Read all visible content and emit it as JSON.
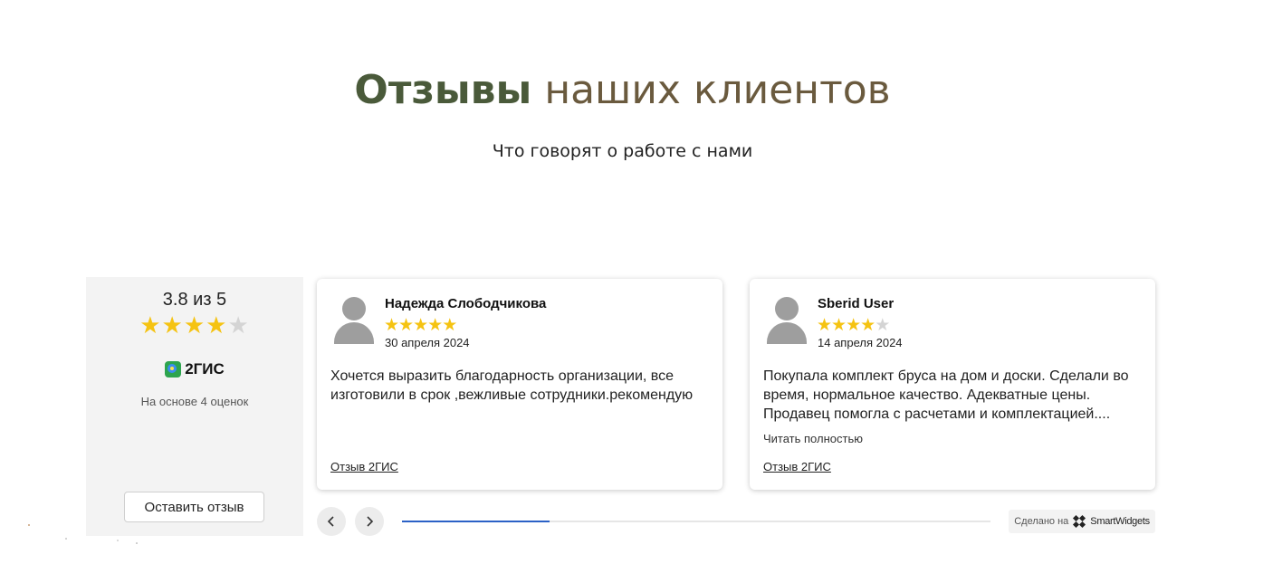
{
  "header": {
    "title_bold": "Отзывы",
    "title_rest": "наших клиентов",
    "subtitle": "Что говорят о работе с нами"
  },
  "summary": {
    "rating_text": "3.8 из 5",
    "rating": 3.8,
    "stars_filled": 4,
    "stars_total": 5,
    "brand": "2ГИС",
    "based_on": "На основе 4 оценок",
    "leave_button": "Оставить отзыв"
  },
  "reviews": [
    {
      "name": "Надежда Слободчикова",
      "stars": 5,
      "date": "30 апреля 2024",
      "text": "Хочется выразить благодарность организации, все изготовили в срок ,вежливые сотрудники.рекомендую",
      "read_more": "",
      "source": "Отзыв 2ГИС"
    },
    {
      "name": "Sberid User",
      "stars": 4,
      "date": "14 апреля 2024",
      "text": "Покупала комплект бруса на дом и доски. Сделали во время, нормальное качество. Адекватные цены. Продавец помогла с расчетами и комплектацией....",
      "read_more": "Читать полностью",
      "source": "Отзыв 2ГИС"
    }
  ],
  "carousel": {
    "progress": 0.25
  },
  "credit": {
    "prefix": "Сделано на",
    "brand": "SmartWidgets"
  },
  "colors": {
    "title_bold": "#4a5a3a",
    "title_light": "#6a5a3e",
    "star": "#f5c312",
    "star_empty": "#d4d4d4",
    "progress": "#2b61c6"
  },
  "icons": {
    "prev": "chevron-left-icon",
    "next": "chevron-right-icon",
    "avatar": "user-avatar-icon",
    "brand": "2gis-logo-icon",
    "credit": "smartwidgets-logo-icon"
  }
}
